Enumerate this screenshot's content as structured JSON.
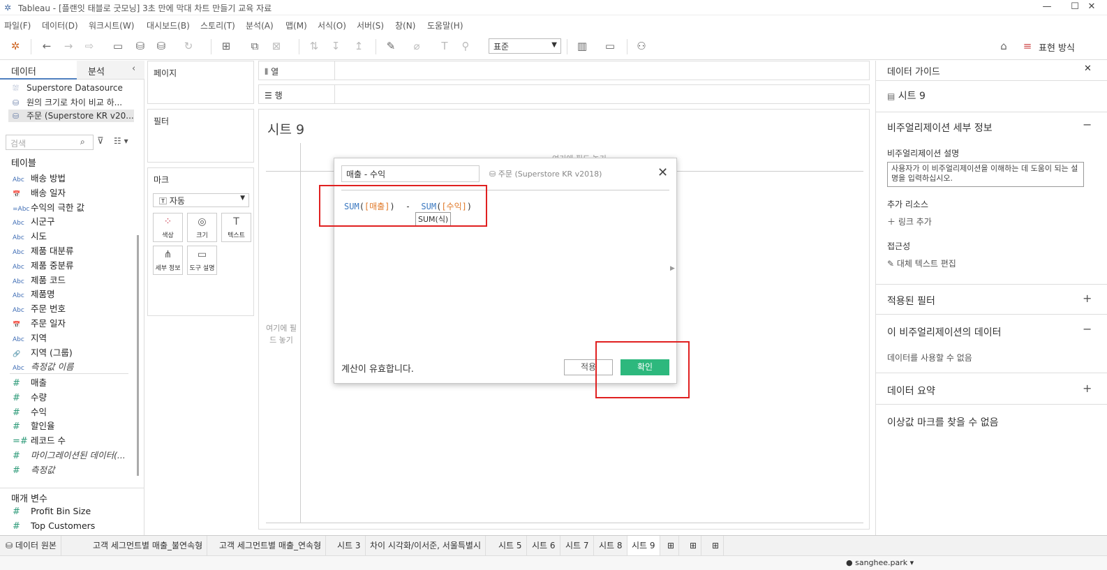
{
  "window": {
    "title": "Tableau - [플랜잇 태블로 굿모닝] 3초 만에 막대 차트 만들기 교육 자료",
    "minimize": "—",
    "maximize": "☐",
    "close": "✕"
  },
  "menu": [
    "파일(F)",
    "데이터(D)",
    "워크시트(W)",
    "대시보드(B)",
    "스토리(T)",
    "분석(A)",
    "맵(M)",
    "서식(O)",
    "서버(S)",
    "창(N)",
    "도움말(H)"
  ],
  "toolbar": {
    "fit_select": "표준",
    "show_me": "표현 방식"
  },
  "left": {
    "tab_data": "데이터",
    "tab_analysis": "분석",
    "datasources": [
      "Superstore Datasource",
      "원의 크기로 차이 비교 하...",
      "주문 (Superstore KR v20..."
    ],
    "search_placeholder": "검색",
    "tables_header": "테이블",
    "dimensions": [
      {
        "icon": "Abc",
        "name": "배송 방법"
      },
      {
        "icon": "📅",
        "name": "배송 일자"
      },
      {
        "icon": "=Abc",
        "name": "수익의 극한 값"
      },
      {
        "icon": "Abc",
        "name": "시군구"
      },
      {
        "icon": "Abc",
        "name": "시도"
      },
      {
        "icon": "Abc",
        "name": "제품 대분류"
      },
      {
        "icon": "Abc",
        "name": "제품 중분류"
      },
      {
        "icon": "Abc",
        "name": "제품 코드"
      },
      {
        "icon": "Abc",
        "name": "제품명"
      },
      {
        "icon": "Abc",
        "name": "주문 번호"
      },
      {
        "icon": "📅",
        "name": "주문 일자"
      },
      {
        "icon": "Abc",
        "name": "지역"
      },
      {
        "icon": "🔗",
        "name": "지역 (그룹)"
      },
      {
        "icon": "Abc",
        "name": "측정값 이름",
        "italic": true
      }
    ],
    "measures": [
      {
        "icon": "#",
        "name": "매출"
      },
      {
        "icon": "#",
        "name": "수량"
      },
      {
        "icon": "#",
        "name": "수익"
      },
      {
        "icon": "#",
        "name": "할인율"
      },
      {
        "icon": "=#",
        "name": "레코드 수"
      },
      {
        "icon": "#",
        "name": "마이그레이션된 데이터(...",
        "italic": true
      },
      {
        "icon": "#",
        "name": "측정값",
        "italic": true
      }
    ],
    "params_header": "매개 변수",
    "params": [
      {
        "icon": "#",
        "name": "Profit Bin Size"
      },
      {
        "icon": "#",
        "name": "Top Customers"
      }
    ]
  },
  "shelves": {
    "pages": "페이지",
    "filters": "필터",
    "marks": "마크",
    "mark_type": "자동",
    "mark_buttons": [
      "색상",
      "크기",
      "텍스트",
      "세부 정보",
      "도구 설명"
    ],
    "columns": "열",
    "rows": "행"
  },
  "canvas": {
    "sheet_title": "시트 9",
    "drop_cols": "여기에 필드 놓기",
    "drop_rows": "여기에 필드 놓기"
  },
  "dialog": {
    "name": "매출 - 수익",
    "source": "주문 (Superstore KR v2018)",
    "f_sum1": "SUM",
    "f_p1": "(",
    "f_field1": "[매출]",
    "f_p2": ")",
    "f_minus": "-",
    "f_sum2": "SUM",
    "f_p3": "(",
    "f_field2": "[수익]",
    "f_p4": ")",
    "tooltip": "SUM(식)",
    "status": "계산이 유효합니다.",
    "apply": "적용",
    "ok": "확인"
  },
  "right": {
    "title": "데이터 가이드",
    "sheet": "시트 9",
    "viz_details": "비주얼리제이션 세부 정보",
    "viz_desc_label": "비주얼리제이션 설명",
    "viz_desc_placeholder": "사용자가 이 비주얼리제이션을 이해하는 데 도움이 되는 설명을 입력하십시오.",
    "extra_resources": "추가 리소스",
    "add_link": "링크 추가",
    "accessibility": "접근성",
    "edit_alt": "대체 텍스트 편집",
    "applied_filters": "적용된 필터",
    "viz_data": "이 비주얼리제이션의 데이터",
    "no_data": "데이터를 사용할 수 없음",
    "data_summary": "데이터 요약",
    "no_outliers": "이상값 마크를 찾을 수 없음"
  },
  "sheet_tabs": [
    "데이터 원본",
    "고객 세그먼트별 매출_불연속형",
    "고객 세그먼트별 매출_연속형",
    "시트 3",
    "차이 시각화/이서준, 서울특별시",
    "시트 5",
    "시트 6",
    "시트 7",
    "시트 8",
    "시트 9"
  ],
  "status": {
    "user": "sanghee.park"
  },
  "colors": {
    "accent": "#2db87d",
    "highlight": "#e02020",
    "function": "#3a78c0",
    "field": "#e07a2a"
  }
}
